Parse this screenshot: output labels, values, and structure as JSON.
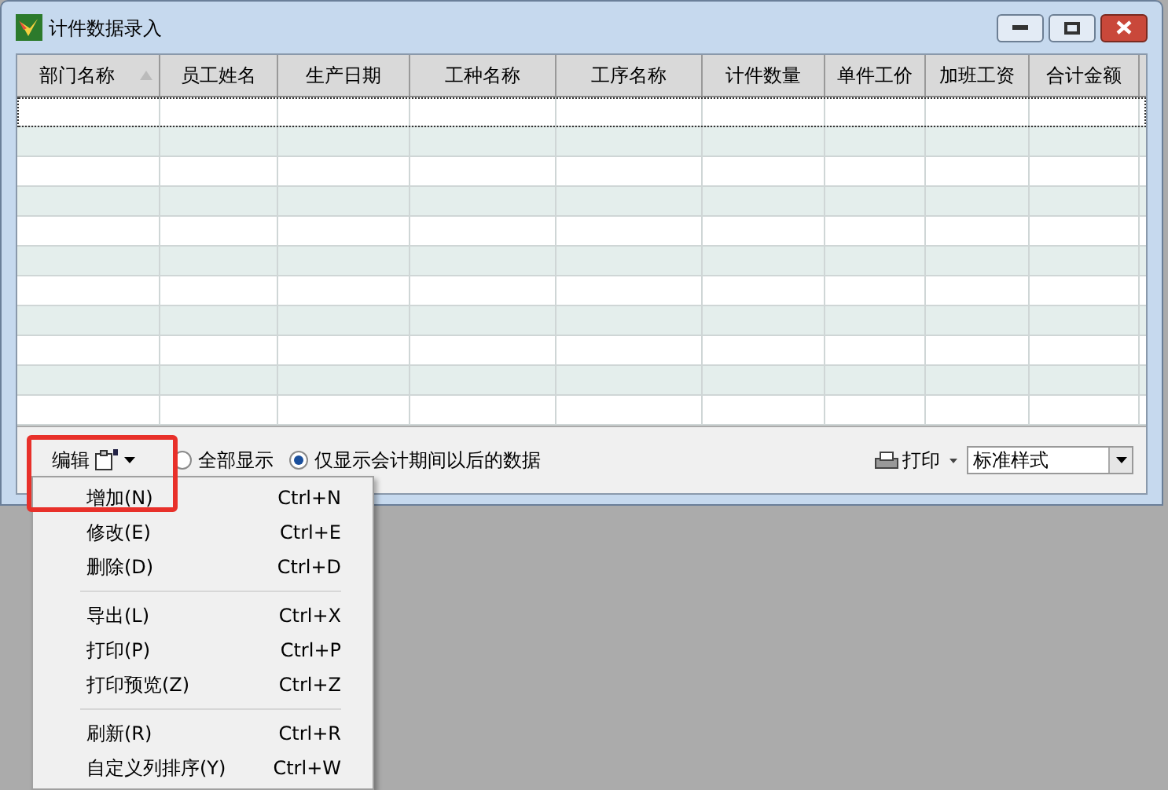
{
  "window": {
    "title": "计件数据录入"
  },
  "table": {
    "columns": [
      {
        "label": "部门名称",
        "sorted": true
      },
      {
        "label": "员工姓名",
        "sorted": false
      },
      {
        "label": "生产日期",
        "sorted": false
      },
      {
        "label": "工种名称",
        "sorted": false
      },
      {
        "label": "工序名称",
        "sorted": false
      },
      {
        "label": "计件数量",
        "sorted": false
      },
      {
        "label": "单件工价",
        "sorted": false
      },
      {
        "label": "加班工资",
        "sorted": false
      },
      {
        "label": "合计金额",
        "sorted": false
      }
    ]
  },
  "toolbar": {
    "edit_button": "编辑",
    "radios": [
      {
        "label": "全部显示",
        "selected": false
      },
      {
        "label": "仅显示会计期间以后的数据",
        "selected": true
      }
    ],
    "print_button": "打印",
    "style_select": "标准样式"
  },
  "menu": {
    "groups": [
      [
        {
          "label": "增加(N)",
          "shortcut": "Ctrl+N"
        },
        {
          "label": "修改(E)",
          "shortcut": "Ctrl+E"
        },
        {
          "label": "删除(D)",
          "shortcut": "Ctrl+D"
        }
      ],
      [
        {
          "label": "导出(L)",
          "shortcut": "Ctrl+X"
        },
        {
          "label": "打印(P)",
          "shortcut": "Ctrl+P"
        },
        {
          "label": "打印预览(Z)",
          "shortcut": "Ctrl+Z"
        }
      ],
      [
        {
          "label": "刷新(R)",
          "shortcut": "Ctrl+R"
        },
        {
          "label": "自定义列排序(Y)",
          "shortcut": "Ctrl+W"
        }
      ]
    ]
  }
}
